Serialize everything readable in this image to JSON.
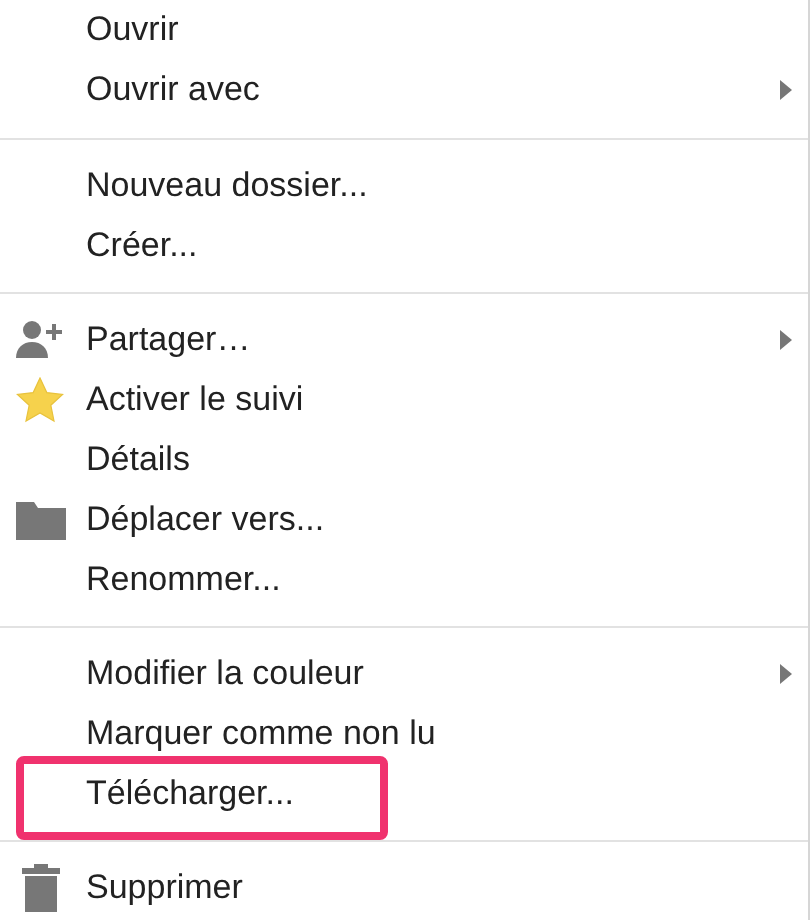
{
  "menu": {
    "sections": [
      {
        "items": [
          {
            "label": "Ouvrir",
            "kind": "plain",
            "submenu": false,
            "highlighted": false
          },
          {
            "label": "Ouvrir avec",
            "kind": "plain",
            "submenu": true,
            "highlighted": false
          }
        ]
      },
      {
        "items": [
          {
            "label": "Nouveau dossier...",
            "kind": "plain",
            "submenu": false,
            "highlighted": false
          },
          {
            "label": "Créer...",
            "kind": "plain",
            "submenu": false,
            "highlighted": false
          }
        ]
      },
      {
        "items": [
          {
            "label": "Partager…",
            "kind": "share",
            "submenu": true,
            "highlighted": false
          },
          {
            "label": "Activer le suivi",
            "kind": "star",
            "submenu": false,
            "highlighted": false
          },
          {
            "label": "Détails",
            "kind": "plain",
            "submenu": false,
            "highlighted": false
          },
          {
            "label": "Déplacer vers...",
            "kind": "folder",
            "submenu": false,
            "highlighted": false
          },
          {
            "label": "Renommer...",
            "kind": "plain",
            "submenu": false,
            "highlighted": false
          }
        ]
      },
      {
        "items": [
          {
            "label": "Modifier la couleur",
            "kind": "plain",
            "submenu": true,
            "highlighted": false
          },
          {
            "label": "Marquer comme non lu",
            "kind": "plain",
            "submenu": false,
            "highlighted": false
          },
          {
            "label": "Télécharger...",
            "kind": "plain",
            "submenu": false,
            "highlighted": true
          }
        ]
      },
      {
        "items": [
          {
            "label": "Supprimer",
            "kind": "trash",
            "submenu": false,
            "highlighted": false
          }
        ]
      }
    ]
  }
}
